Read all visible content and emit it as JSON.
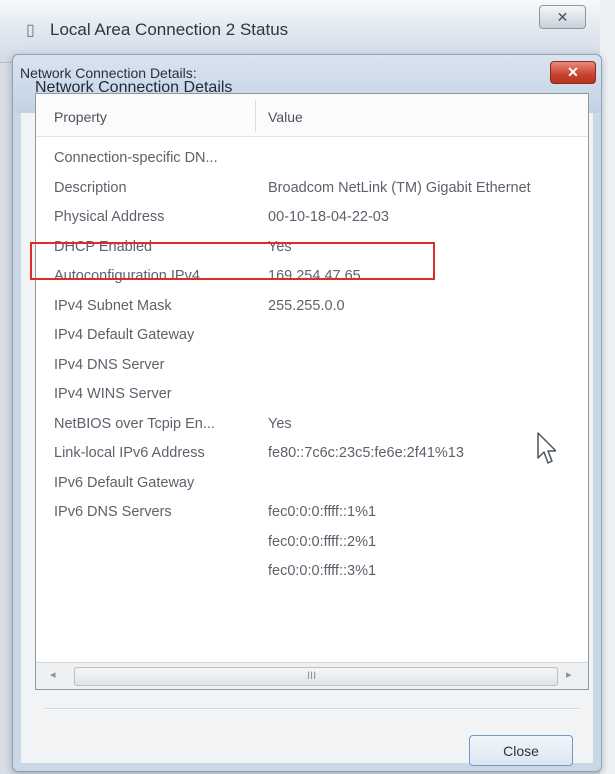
{
  "background_window": {
    "title": "Local Area Connection 2 Status",
    "close_label": "✕"
  },
  "dialog": {
    "title": "Network Connection Details",
    "close_label": "✕",
    "section_label": "Network Connection Details:",
    "close_button_label": "Close"
  },
  "table": {
    "columns": [
      "Property",
      "Value"
    ],
    "rows": [
      {
        "property": "Connection-specific DN...",
        "value": ""
      },
      {
        "property": "Description",
        "value": "Broadcom NetLink (TM) Gigabit Ethernet"
      },
      {
        "property": "Physical Address",
        "value": "00-10-18-04-22-03"
      },
      {
        "property": "DHCP Enabled",
        "value": "Yes"
      },
      {
        "property": "Autoconfiguration IPv4 ...",
        "value": "169.254.47.65"
      },
      {
        "property": "IPv4 Subnet Mask",
        "value": "255.255.0.0"
      },
      {
        "property": "IPv4 Default Gateway",
        "value": ""
      },
      {
        "property": "IPv4 DNS Server",
        "value": ""
      },
      {
        "property": "IPv4 WINS Server",
        "value": ""
      },
      {
        "property": "NetBIOS over Tcpip En...",
        "value": "Yes"
      },
      {
        "property": "Link-local IPv6 Address",
        "value": "fe80::7c6c:23c5:fe6e:2f41%13"
      },
      {
        "property": "IPv6 Default Gateway",
        "value": ""
      },
      {
        "property": "IPv6 DNS Servers",
        "value": "fec0:0:0:ffff::1%1"
      },
      {
        "property": "",
        "value": "fec0:0:0:ffff::2%1"
      },
      {
        "property": "",
        "value": "fec0:0:0:ffff::3%1"
      }
    ],
    "highlighted_property": "Physical Address"
  },
  "scrollbar": {
    "left_arrow": "◂",
    "right_arrow": "▸",
    "grip": "III"
  },
  "colors": {
    "highlight_border": "#e02b2b",
    "dialog_close": "#c8432e"
  },
  "icons": {
    "window_icon": "network-status-icon",
    "cursor": "mouse-pointer-icon"
  }
}
